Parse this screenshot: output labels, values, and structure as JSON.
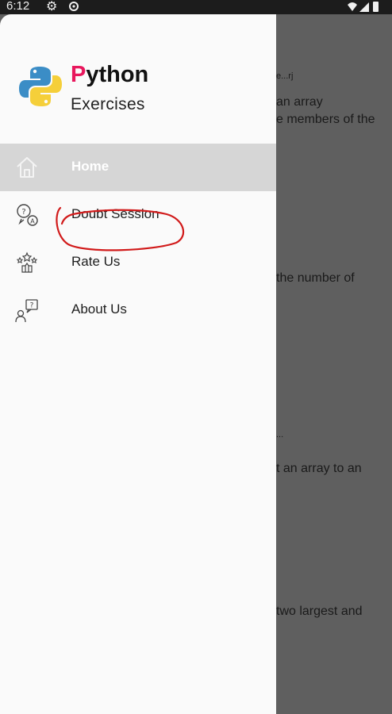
{
  "status_bar": {
    "time": "6:12",
    "icons": [
      "settings-icon",
      "sync-icon",
      "wifi-icon",
      "signal-icon",
      "battery-icon"
    ]
  },
  "drawer": {
    "brand": {
      "title_first_letter": "P",
      "title_rest": "ython",
      "subtitle": "Exercises"
    },
    "menu": [
      {
        "label": "Home",
        "icon": "home-icon",
        "active": true
      },
      {
        "label": "Doubt Session",
        "icon": "doubt-session-icon",
        "active": false
      },
      {
        "label": "Rate Us",
        "icon": "rate-us-icon",
        "active": false
      },
      {
        "label": "About Us",
        "icon": "about-us-icon",
        "active": false
      }
    ]
  },
  "background_content": {
    "lines": [
      "e...rj",
      "an array",
      "e members of the",
      "the number of",
      "...",
      "t an array to an",
      "two largest and"
    ]
  },
  "colors": {
    "accent": "#e8175d",
    "active_item_bg": "#d6d6d6",
    "scrim": "#5f5f5f",
    "annotation": "#d11a1a"
  }
}
